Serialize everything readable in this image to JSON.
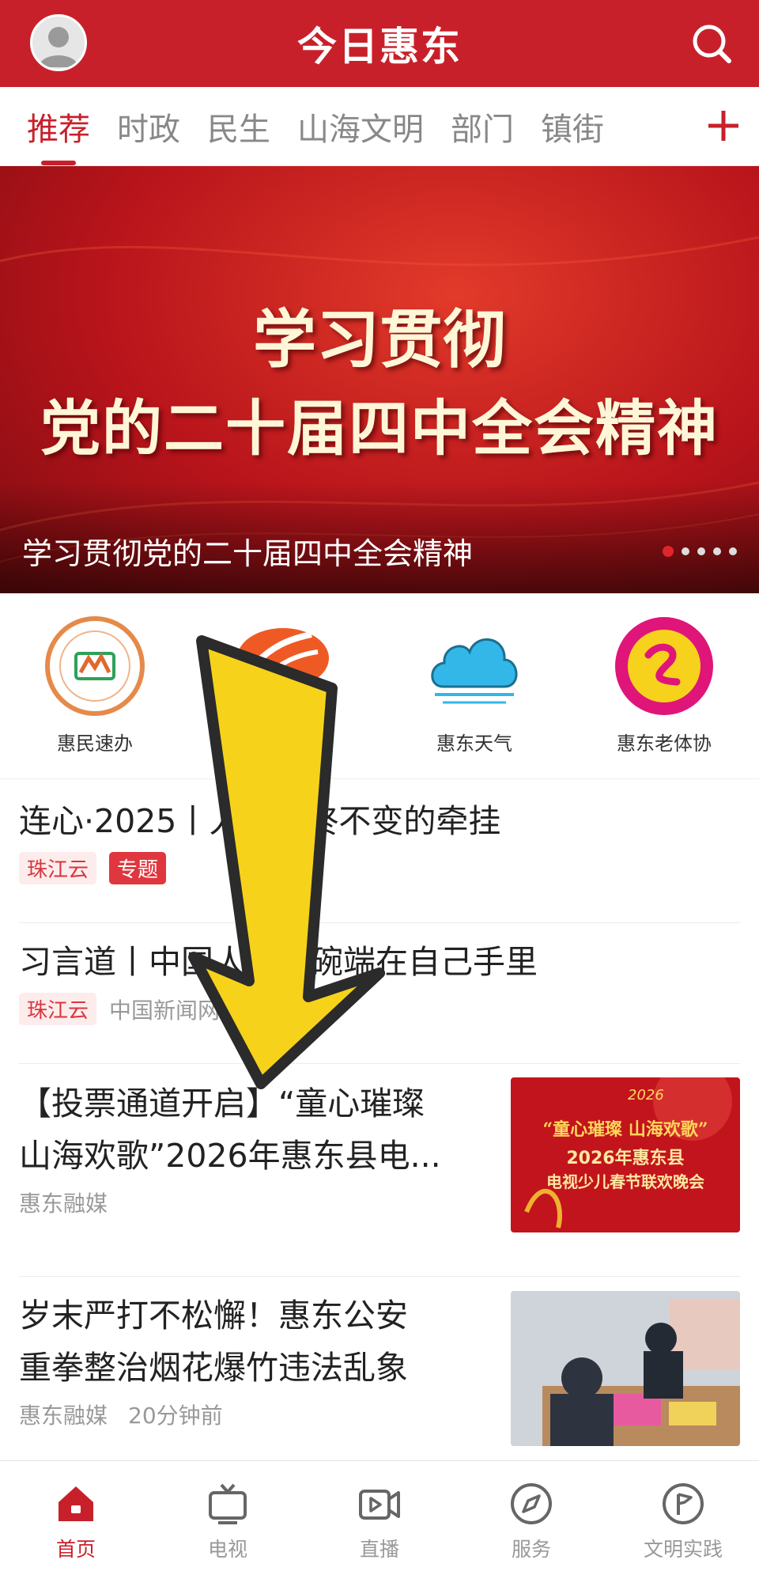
{
  "header": {
    "title": "今日惠东",
    "avatar_icon": "user-avatar-icon",
    "search_icon": "search-icon"
  },
  "tabs": {
    "items": [
      {
        "label": "推荐",
        "active": true
      },
      {
        "label": "时政"
      },
      {
        "label": "民生"
      },
      {
        "label": "山海文明"
      },
      {
        "label": "部门"
      },
      {
        "label": "镇街"
      }
    ],
    "add_icon": "plus-icon"
  },
  "banner": {
    "line1": "学习贯彻",
    "line2": "党的二十届四中全会精神",
    "caption": "学习贯彻党的二十届四中全会精神",
    "page_count": 5,
    "active_index": 0
  },
  "services": [
    {
      "label": "惠民速办",
      "icon": "hotline-12345-icon"
    },
    {
      "label": "",
      "icon": "orange-logo-icon"
    },
    {
      "label": "惠东天气",
      "icon": "cloud-icon"
    },
    {
      "label": "惠东老体协",
      "icon": "elderly-sports-logo-icon"
    }
  ],
  "news": [
    {
      "title": "连心·2025丨人民始终不变的牵挂",
      "tags": [
        "珠江云",
        "专题"
      ]
    },
    {
      "title": "习言道丨中国人的饭碗端在自己手里",
      "tags": [
        "珠江云"
      ],
      "source": "中国新闻网"
    },
    {
      "title_line1": "【投票通道开启】“童心璀璨",
      "title_line2": "山海欢歌”2026年惠东县电...",
      "source": "惠东融媒",
      "thumb_text1": "“童心璀璨 山海欢歌”",
      "thumb_text2": "2026年惠东县",
      "thumb_text3": "电视少儿春节联欢晚会",
      "thumb_year": "2026"
    },
    {
      "title_line1": "岁末严打不松懈！惠东公安",
      "title_line2": "重拳整治烟花爆竹违法乱象",
      "source": "惠东融媒",
      "time": "20分钟前"
    }
  ],
  "bottom_nav": [
    {
      "label": "首页",
      "icon": "home-icon",
      "active": true
    },
    {
      "label": "电视",
      "icon": "tv-icon"
    },
    {
      "label": "直播",
      "icon": "live-video-icon"
    },
    {
      "label": "服务",
      "icon": "compass-icon"
    },
    {
      "label": "文明实践",
      "icon": "flag-circle-icon"
    }
  ],
  "colors": {
    "brand": "#c8202a",
    "arrow": "#f6d31a"
  }
}
